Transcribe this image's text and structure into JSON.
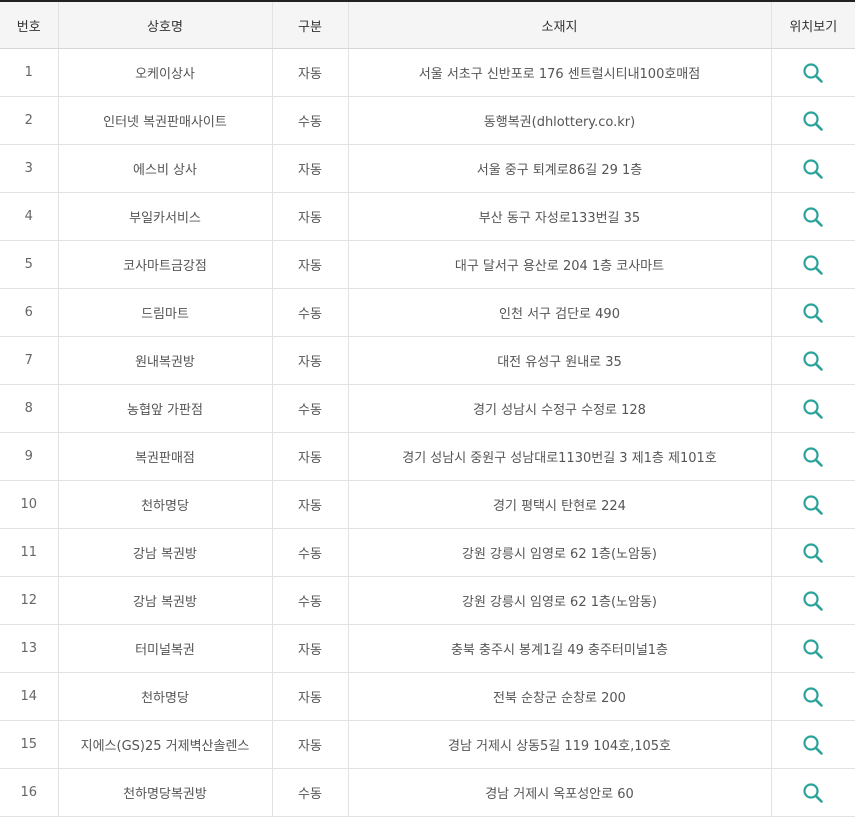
{
  "table": {
    "headers": {
      "number": "번호",
      "name": "상호명",
      "type": "구분",
      "address": "소재지",
      "map": "위치보기"
    },
    "accent_color": "#2aa39a",
    "action_icon": "search-icon",
    "rows": [
      {
        "number": "1",
        "name": "오케이상사",
        "type": "자동",
        "address": "서울 서초구 신반포로 176 센트럴시티내100호매점"
      },
      {
        "number": "2",
        "name": "인터넷 복권판매사이트",
        "type": "수동",
        "address": "동행복권(dhlottery.co.kr)"
      },
      {
        "number": "3",
        "name": "에스비 상사",
        "type": "자동",
        "address": "서울 중구 퇴계로86길 29 1층"
      },
      {
        "number": "4",
        "name": "부일카서비스",
        "type": "자동",
        "address": "부산 동구 자성로133번길 35"
      },
      {
        "number": "5",
        "name": "코사마트금강점",
        "type": "자동",
        "address": "대구 달서구 용산로 204 1층 코사마트"
      },
      {
        "number": "6",
        "name": "드림마트",
        "type": "수동",
        "address": "인천 서구 검단로 490"
      },
      {
        "number": "7",
        "name": "원내복권방",
        "type": "자동",
        "address": "대전 유성구 원내로 35"
      },
      {
        "number": "8",
        "name": "농협앞 가판점",
        "type": "수동",
        "address": "경기 성남시 수정구 수정로 128"
      },
      {
        "number": "9",
        "name": "복권판매점",
        "type": "자동",
        "address": "경기 성남시 중원구 성남대로1130번길 3 제1층 제101호"
      },
      {
        "number": "10",
        "name": "천하명당",
        "type": "자동",
        "address": "경기 평택시 탄현로 224"
      },
      {
        "number": "11",
        "name": "강남 복권방",
        "type": "수동",
        "address": "강원 강릉시 임영로 62 1층(노암동)"
      },
      {
        "number": "12",
        "name": "강남 복권방",
        "type": "수동",
        "address": "강원 강릉시 임영로 62 1층(노암동)"
      },
      {
        "number": "13",
        "name": "터미널복권",
        "type": "자동",
        "address": "충북 충주시 봉계1길 49 충주터미널1층"
      },
      {
        "number": "14",
        "name": "천하명당",
        "type": "자동",
        "address": "전북 순창군 순창로 200"
      },
      {
        "number": "15",
        "name": "지에스(GS)25 거제벽산솔렌스",
        "type": "자동",
        "address": "경남 거제시 상동5길 119 104호,105호"
      },
      {
        "number": "16",
        "name": "천하명당복권방",
        "type": "수동",
        "address": "경남 거제시 옥포성안로 60"
      }
    ]
  }
}
